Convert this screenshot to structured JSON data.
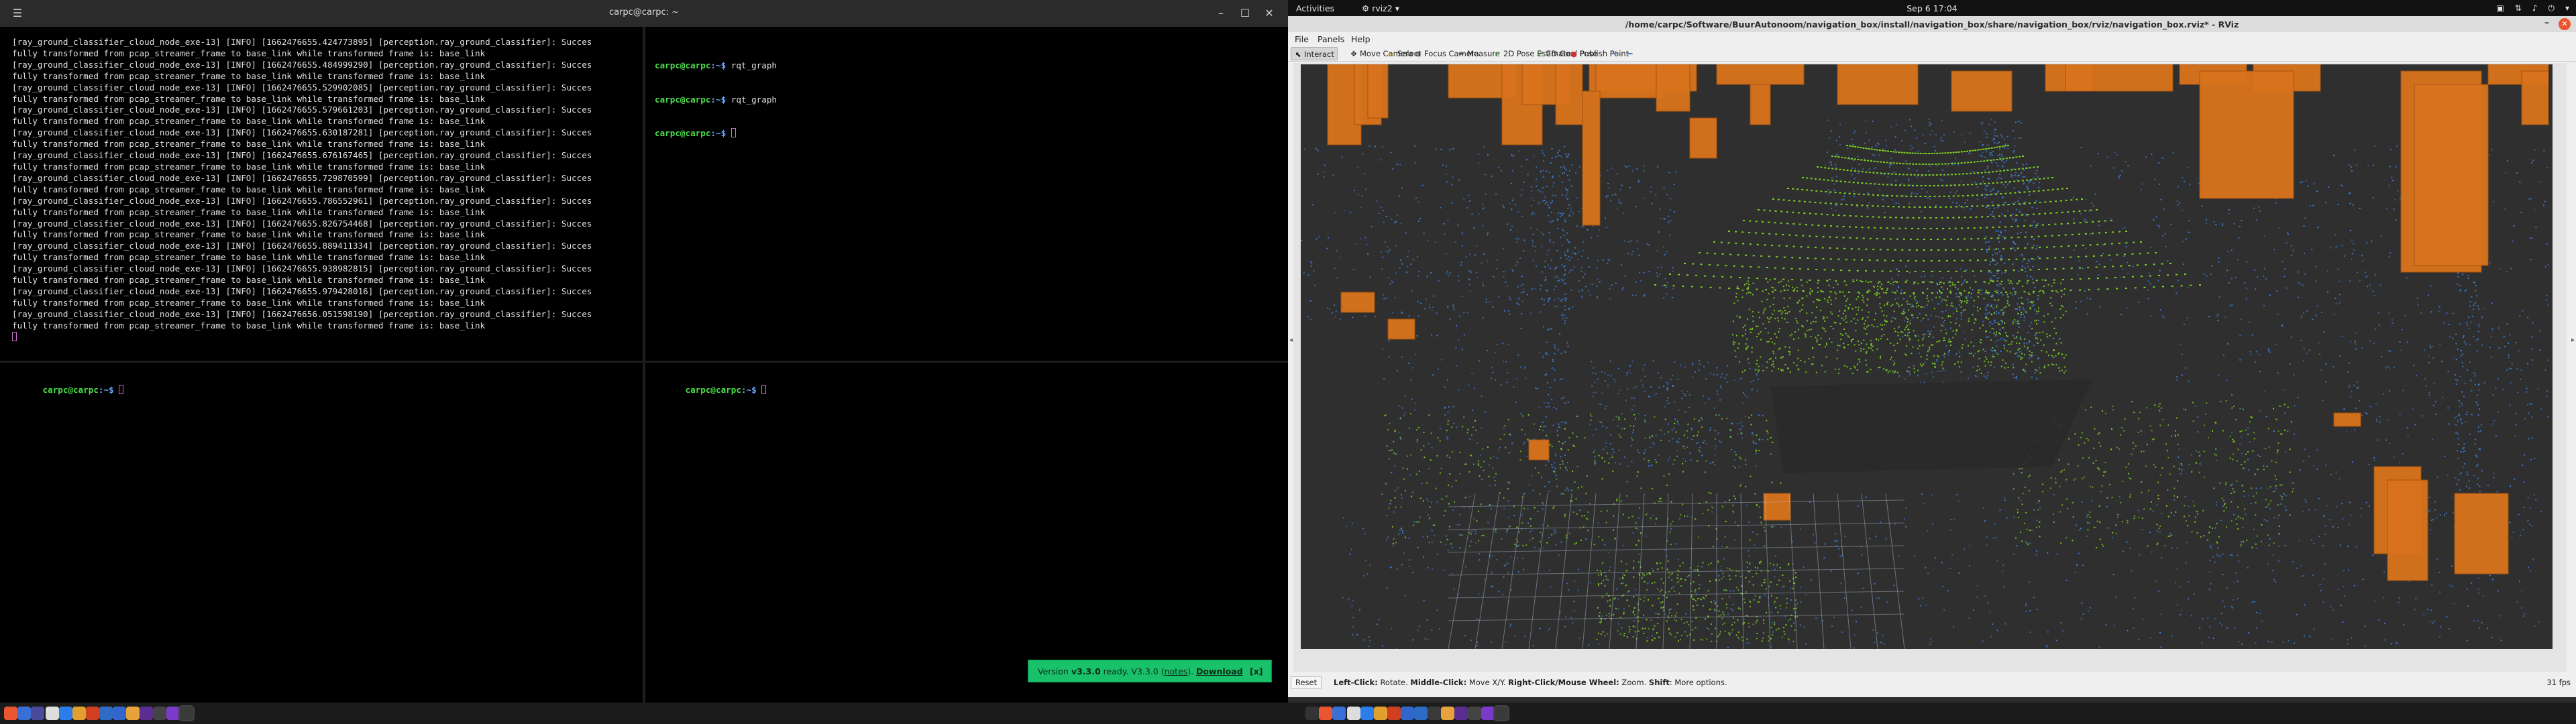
{
  "terminal": {
    "title": "carpc@carpc: ~",
    "log_lines": [
      "[ray_ground_classifier_cloud_node_exe-13] [INFO] [1662476655.424773895] [perception.ray_ground_classifier]: Succes",
      "fully transformed from pcap_streamer_frame to base_link while transformed frame is: base_link",
      "[ray_ground_classifier_cloud_node_exe-13] [INFO] [1662476655.484999290] [perception.ray_ground_classifier]: Succes",
      "fully transformed from pcap_streamer_frame to base_link while transformed frame is: base_link",
      "[ray_ground_classifier_cloud_node_exe-13] [INFO] [1662476655.529902085] [perception.ray_ground_classifier]: Succes",
      "fully transformed from pcap_streamer_frame to base_link while transformed frame is: base_link",
      "[ray_ground_classifier_cloud_node_exe-13] [INFO] [1662476655.579661203] [perception.ray_ground_classifier]: Succes",
      "fully transformed from pcap_streamer_frame to base_link while transformed frame is: base_link",
      "[ray_ground_classifier_cloud_node_exe-13] [INFO] [1662476655.630187281] [perception.ray_ground_classifier]: Succes",
      "fully transformed from pcap_streamer_frame to base_link while transformed frame is: base_link",
      "[ray_ground_classifier_cloud_node_exe-13] [INFO] [1662476655.676167465] [perception.ray_ground_classifier]: Succes",
      "fully transformed from pcap_streamer_frame to base_link while transformed frame is: base_link",
      "[ray_ground_classifier_cloud_node_exe-13] [INFO] [1662476655.729870599] [perception.ray_ground_classifier]: Succes",
      "fully transformed from pcap_streamer_frame to base_link while transformed frame is: base_link",
      "[ray_ground_classifier_cloud_node_exe-13] [INFO] [1662476655.786552961] [perception.ray_ground_classifier]: Succes",
      "fully transformed from pcap_streamer_frame to base_link while transformed frame is: base_link",
      "[ray_ground_classifier_cloud_node_exe-13] [INFO] [1662476655.826754468] [perception.ray_ground_classifier]: Succes",
      "fully transformed from pcap_streamer_frame to base_link while transformed frame is: base_link",
      "[ray_ground_classifier_cloud_node_exe-13] [INFO] [1662476655.889411334] [perception.ray_ground_classifier]: Succes",
      "fully transformed from pcap_streamer_frame to base_link while transformed frame is: base_link",
      "[ray_ground_classifier_cloud_node_exe-13] [INFO] [1662476655.938982815] [perception.ray_ground_classifier]: Succes",
      "fully transformed from pcap_streamer_frame to base_link while transformed frame is: base_link",
      "[ray_ground_classifier_cloud_node_exe-13] [INFO] [1662476655.979428016] [perception.ray_ground_classifier]: Succes",
      "fully transformed from pcap_streamer_frame to base_link while transformed frame is: base_link",
      "[ray_ground_classifier_cloud_node_exe-13] [INFO] [1662476656.051598190] [perception.ray_ground_classifier]: Succes",
      "fully transformed from pcap_streamer_frame to base_link while transformed frame is: base_link"
    ],
    "prompt_user": "carpc@carpc",
    "prompt_path": ":~$",
    "top_right_commands": [
      "rqt_graph",
      "rqt_graph",
      ""
    ],
    "toast": {
      "prefix": "Version ",
      "version": "v3.3.0",
      "ready_text": " ready. V3.3.0 (",
      "notes": "notes",
      "suffix": ").",
      "download": "Download",
      "close": "[x]"
    }
  },
  "topbar": {
    "activities": "Activities",
    "app_name": "rviz2",
    "clock": "Sep 6  17:04"
  },
  "rviz": {
    "title": "/home/carpc/Software/BuurAutonoom/navigation_box/install/navigation_box/share/navigation_box/rviz/navigation_box.rviz* - RViz",
    "menu": {
      "file": "File",
      "panels": "Panels",
      "help": "Help"
    },
    "tools": [
      {
        "label": "Interact",
        "icon": "cursor-icon"
      },
      {
        "label": "Move Camera",
        "icon": "move-camera-icon"
      },
      {
        "label": "Select",
        "icon": "select-icon"
      },
      {
        "label": "Focus Camera",
        "icon": "focus-camera-icon"
      },
      {
        "label": "Measure",
        "icon": "ruler-icon"
      },
      {
        "label": "2D Pose Estimate",
        "icon": "pose-estimate-arrow-icon"
      },
      {
        "label": "2D Goal Pose",
        "icon": "goal-pose-arrow-icon"
      },
      {
        "label": "Publish Point",
        "icon": "pin-icon"
      }
    ],
    "status": {
      "reset": "Reset",
      "left_click": "Left-Click:",
      "left_text": " Rotate. ",
      "middle_click": "Middle-Click:",
      "middle_text": " Move X/Y. ",
      "right_click": "Right-Click/Mouse Wheel:",
      "right_text": " Zoom. ",
      "shift": "Shift",
      "shift_text": ": More options.",
      "fps": "31 fps"
    },
    "colors": {
      "background": "#2f2f2f",
      "non_ground_points": "#3f7fd6",
      "ground_points": "#7ed321",
      "bounding_boxes": "#d9731c"
    }
  }
}
